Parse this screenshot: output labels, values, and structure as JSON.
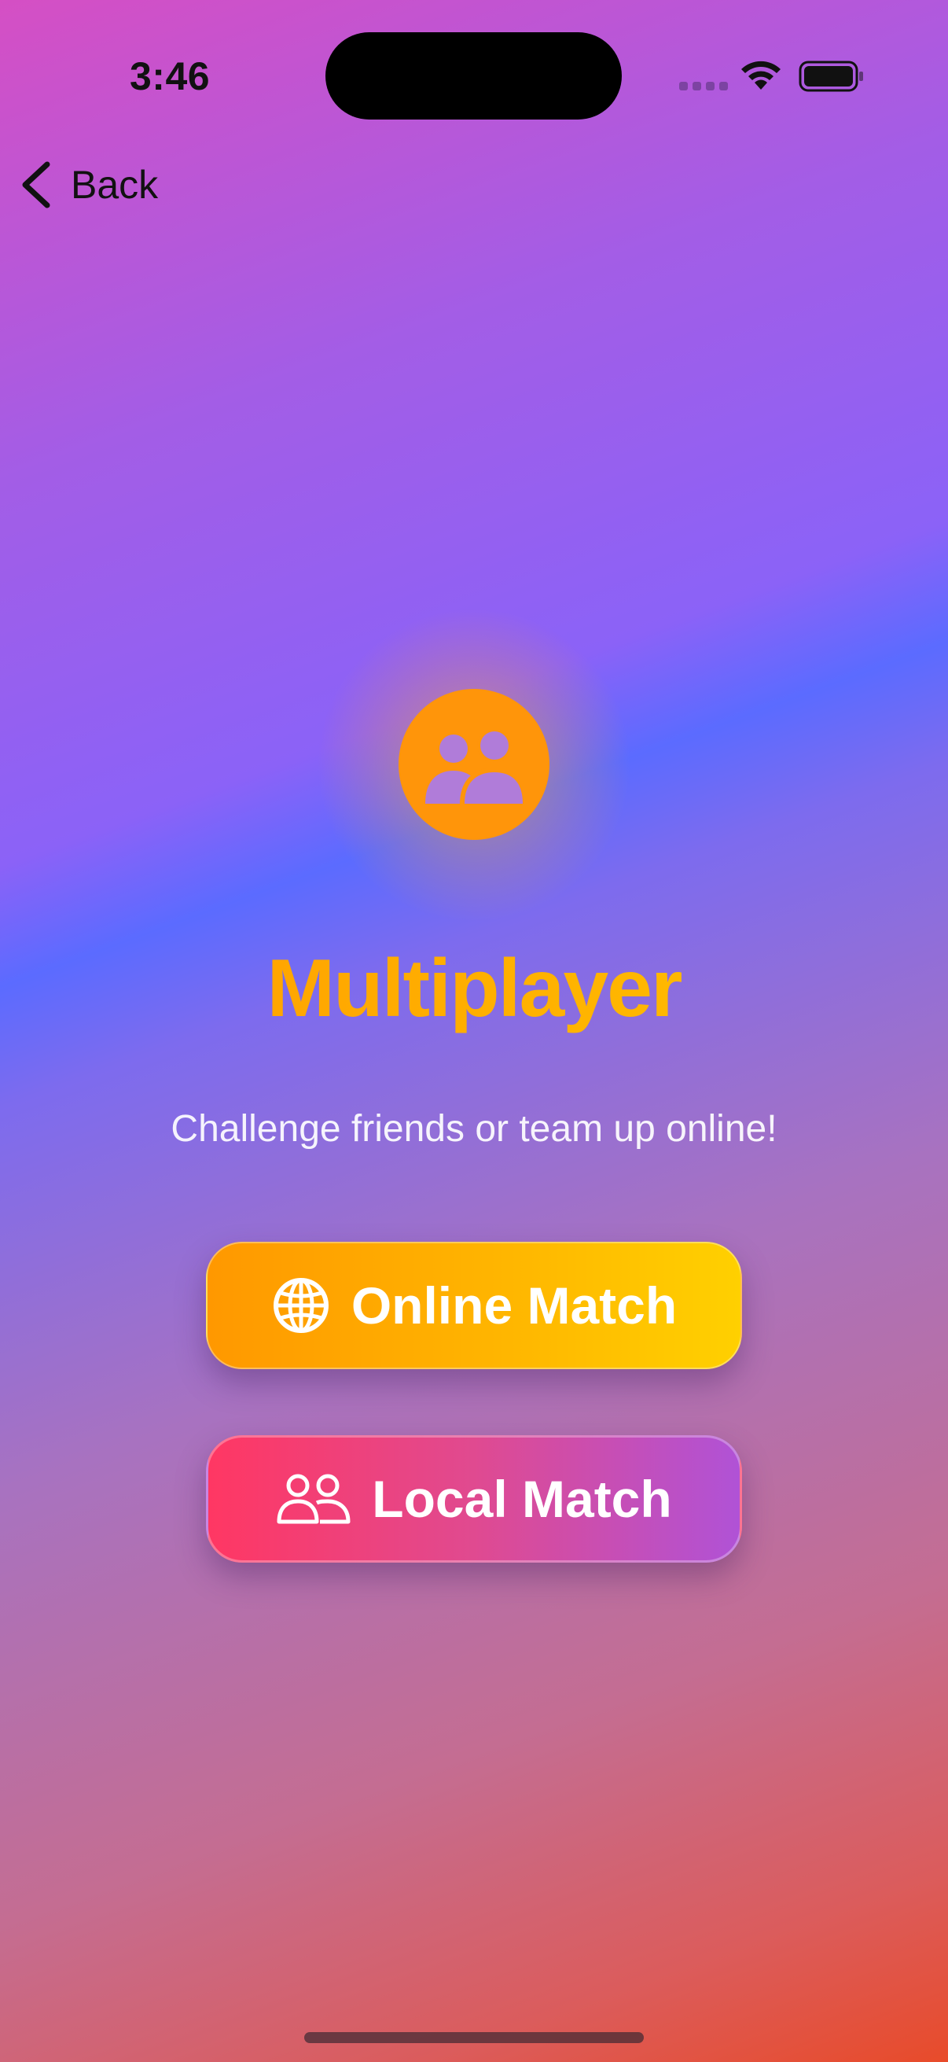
{
  "status_bar": {
    "time": "3:46",
    "icons": [
      "cellular-signal-icon",
      "wifi-icon",
      "battery-icon"
    ]
  },
  "nav": {
    "back_label": "Back"
  },
  "hero": {
    "icon": "multiplayer-people-icon",
    "title": "Multiplayer",
    "subtitle": "Challenge friends or team up online!"
  },
  "actions": {
    "online": {
      "label": "Online Match",
      "icon": "globe-icon"
    },
    "local": {
      "label": "Local Match",
      "icon": "two-people-icon"
    }
  },
  "colors": {
    "accent_orange": "#ff950a",
    "online_gradient": [
      "#ff9800",
      "#ffd000"
    ],
    "local_gradient": [
      "#ff3763",
      "#b052d6"
    ]
  }
}
